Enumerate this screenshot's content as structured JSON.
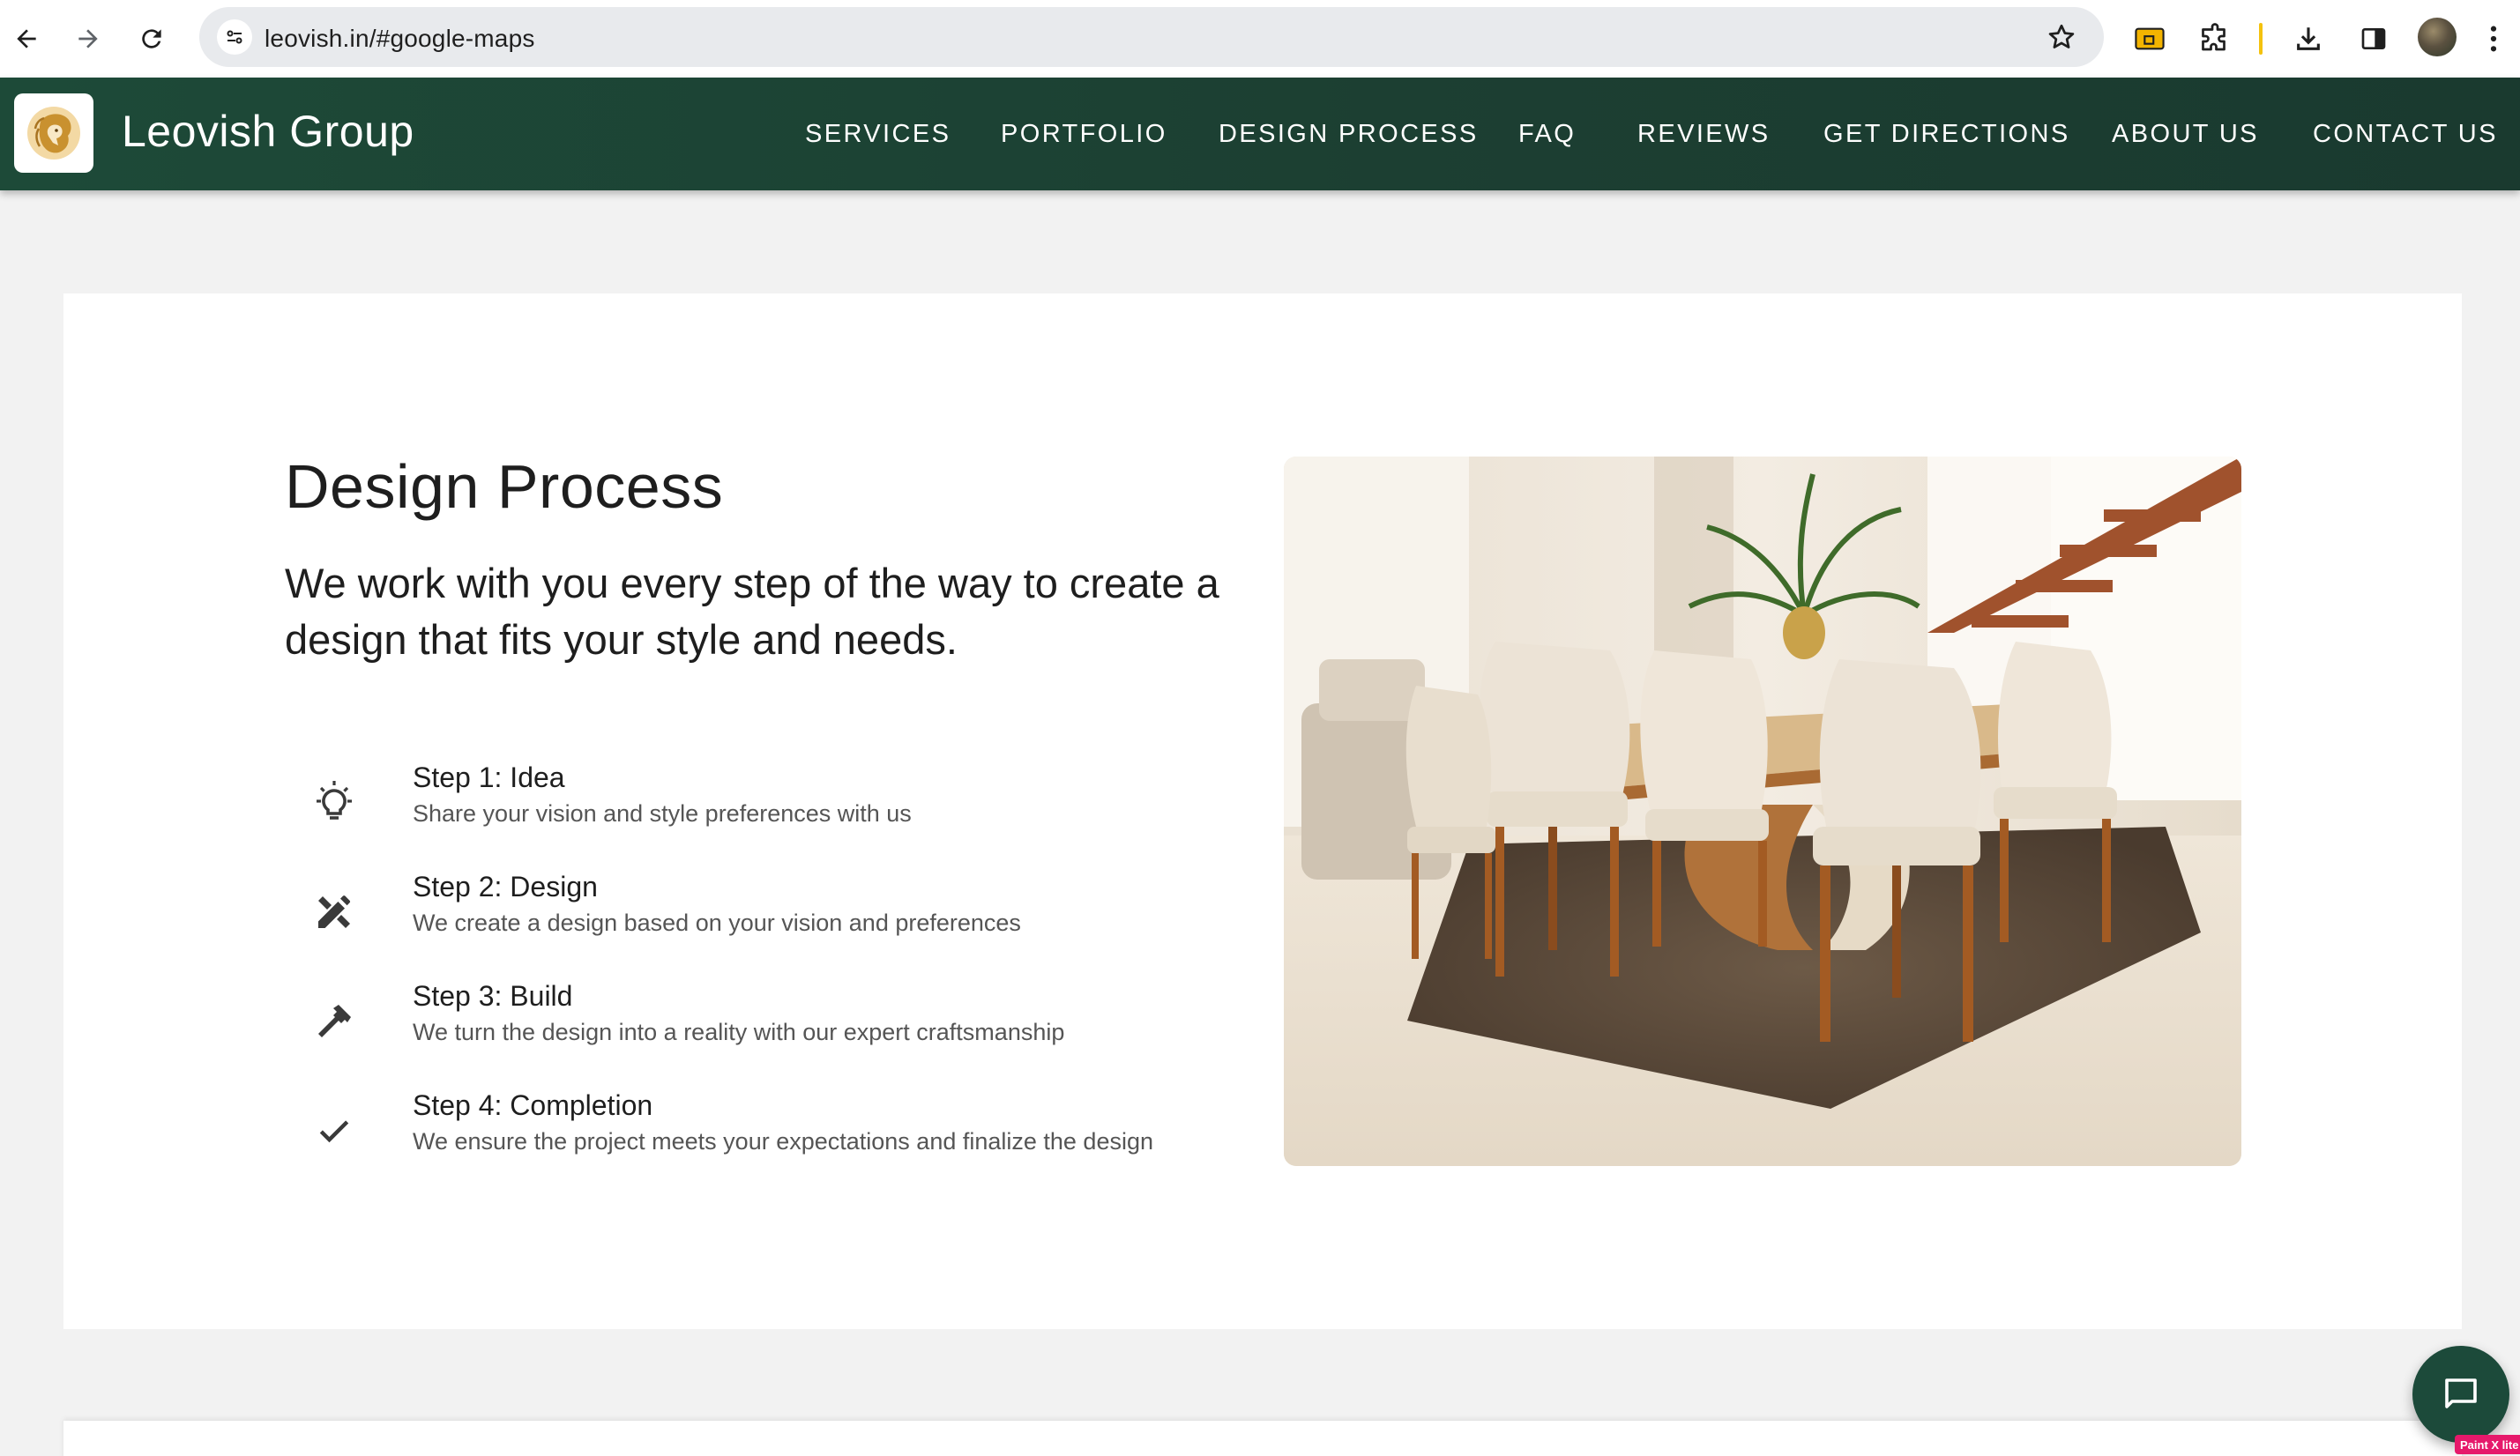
{
  "browser": {
    "url": "leovish.in/#google-maps",
    "icons": [
      "back-arrow-icon",
      "forward-arrow-icon",
      "reload-icon",
      "site-settings-icon",
      "bookmark-star-icon",
      "cast-extension-icon",
      "puzzle-extensions-icon",
      "download-icon",
      "side-panel-icon",
      "profile-avatar",
      "kebab-menu-icon"
    ]
  },
  "header": {
    "brand": "Leovish Group",
    "logo_icon": "lion-logo-icon",
    "nav": [
      "SERVICES",
      "PORTFOLIO",
      "DESIGN PROCESS",
      "FAQ",
      "REVIEWS",
      "GET DIRECTIONS",
      "ABOUT US",
      "CONTACT US"
    ],
    "background": "#1c4034"
  },
  "section": {
    "title": "Design Process",
    "subtitle": "We work with you every step of the way to create a design that fits your style and needs.",
    "steps": [
      {
        "title": "Step 1: Idea",
        "description": "Share your vision and style preferences with us",
        "icon": "lightbulb-icon"
      },
      {
        "title": "Step 2: Design",
        "description": "We create a design based on your vision and preferences",
        "icon": "design-tools-icon"
      },
      {
        "title": "Step 3: Build",
        "description": "We turn the design into a reality with our expert craftsmanship",
        "icon": "hammer-icon"
      },
      {
        "title": "Step 4: Completion",
        "description": "We ensure the project meets your expectations and finalize the design",
        "icon": "checkmark-icon"
      }
    ],
    "image": "dining-room-photo"
  },
  "chat": {
    "icon": "chat-icon",
    "color": "#1c4a3a"
  },
  "badge": {
    "label": "Paint X lite",
    "color": "#e6196b"
  }
}
